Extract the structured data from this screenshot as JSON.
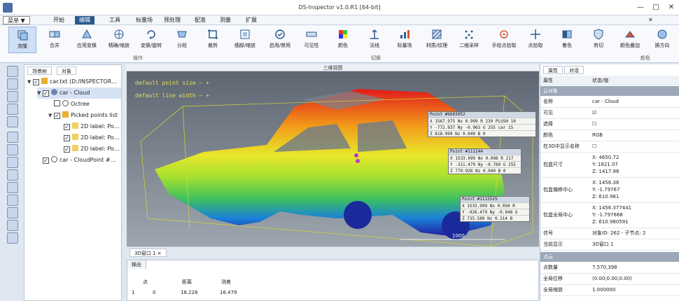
{
  "window": {
    "title": "DS-Inspector v1.0.R1 [64-bit]"
  },
  "menubar": {
    "main": "菜单 ▼",
    "items": [
      "开始",
      "编辑",
      "工具",
      "标量场",
      "预处理",
      "配准",
      "测量",
      "扩展"
    ],
    "active_index": 1
  },
  "ribbon": {
    "buttons": [
      "克隆",
      "合并",
      "应用变换",
      "精确/缩放",
      "变换/旋转",
      "分段",
      "裁剪",
      "细部/缩放",
      "启用/禁用",
      "可见性",
      "颜色",
      "法线",
      "标量场",
      "材质/纹理",
      "二维采样",
      "手绘点拾取",
      "点拾取",
      "着色",
      "剪切",
      "颜色叠加",
      "换方向"
    ],
    "groups": [
      "操作",
      "切换",
      "颜色"
    ]
  },
  "db_panel": {
    "tabs": [
      "场景树",
      "对象"
    ],
    "tree": [
      {
        "label": "car.txt (D:/INSPECTOR…",
        "checked": true,
        "level": 0
      },
      {
        "label": "car - Cloud",
        "checked": true,
        "level": 1
      },
      {
        "label": "Octree",
        "checked": false,
        "level": 2
      },
      {
        "label": "Picked points list",
        "checked": true,
        "level": 2
      },
      {
        "label": "2D label: Po…",
        "checked": true,
        "level": 3
      },
      {
        "label": "2D label: Po…",
        "checked": true,
        "level": 3
      },
      {
        "label": "2D label: Po…",
        "checked": true,
        "level": 3
      },
      {
        "label": "car - CloudPoint #…",
        "checked": true,
        "level": 1
      }
    ]
  },
  "viewport": {
    "title": "三维视图",
    "overlay": [
      "default point size  —  +",
      "default line width  —  +"
    ],
    "points": [
      {
        "title": "Point #6603952",
        "rows": [
          "X  1567.975  Nx  0.999  R  239  PLUSH  10",
          "Y  -772.937  Ny  -0.963  G  255   car  15",
          "Z   818.999  Nz  0.049  B    0"
        ]
      },
      {
        "title": "Point #111244",
        "rows": [
          "X  1533.999  Nx  0.098  R  217",
          "Y  -311.479  Ny  -0.760  G  255",
          "Z   779.926  Nz  0.949  B    0"
        ]
      },
      {
        "title": "Point #1115525",
        "rows": [
          "X  1533.999  Nx  0.050  R",
          "Y  -926.479  Ny  -0.948  G",
          "Z   735.580  Nz  0.314  B"
        ]
      }
    ],
    "scale": "1000"
  },
  "view_tab": {
    "label": "3D窗口 1  ×"
  },
  "console": {
    "title": "输出",
    "headers": [
      "",
      "点",
      "距离",
      "测差"
    ],
    "row": [
      "1",
      "0",
      "18.228",
      "16.479"
    ]
  },
  "prop_panel": {
    "tabs": [
      "属性",
      "对话"
    ],
    "header": {
      "k": "属性",
      "v": "状态/值"
    },
    "section1": "云对象",
    "rows": [
      {
        "k": "名称",
        "v": "car - Cloud"
      },
      {
        "k": "可见",
        "v": "☑"
      },
      {
        "k": "选择",
        "v": "☐"
      },
      {
        "k": "颜色",
        "v": "RGB"
      },
      {
        "k": "在3D中显示名称",
        "v": "☐"
      },
      {
        "k": "包盒尺寸",
        "v": "X: 4650.72\nY: 1821.07\nZ: 1417.98"
      },
      {
        "k": "包盒偏移中心",
        "v": "X: 1456.38\nY: -1.79767\nZ: 610.981"
      },
      {
        "k": "包盒全局中心",
        "v": "X: 1456.377441\nY: -1.797668\nZ: 610.980591"
      },
      {
        "k": "信号",
        "v": "对象ID: 262 - 子节点: 2"
      },
      {
        "k": "当前显示",
        "v": "3D窗口 1"
      }
    ],
    "section2": "点云",
    "rows2": [
      {
        "k": "点数量",
        "v": "7,570,398"
      },
      {
        "k": "全局位移",
        "v": "(0.00;0.00;0.00)"
      },
      {
        "k": "全局缩放",
        "v": "1.000000"
      }
    ]
  }
}
